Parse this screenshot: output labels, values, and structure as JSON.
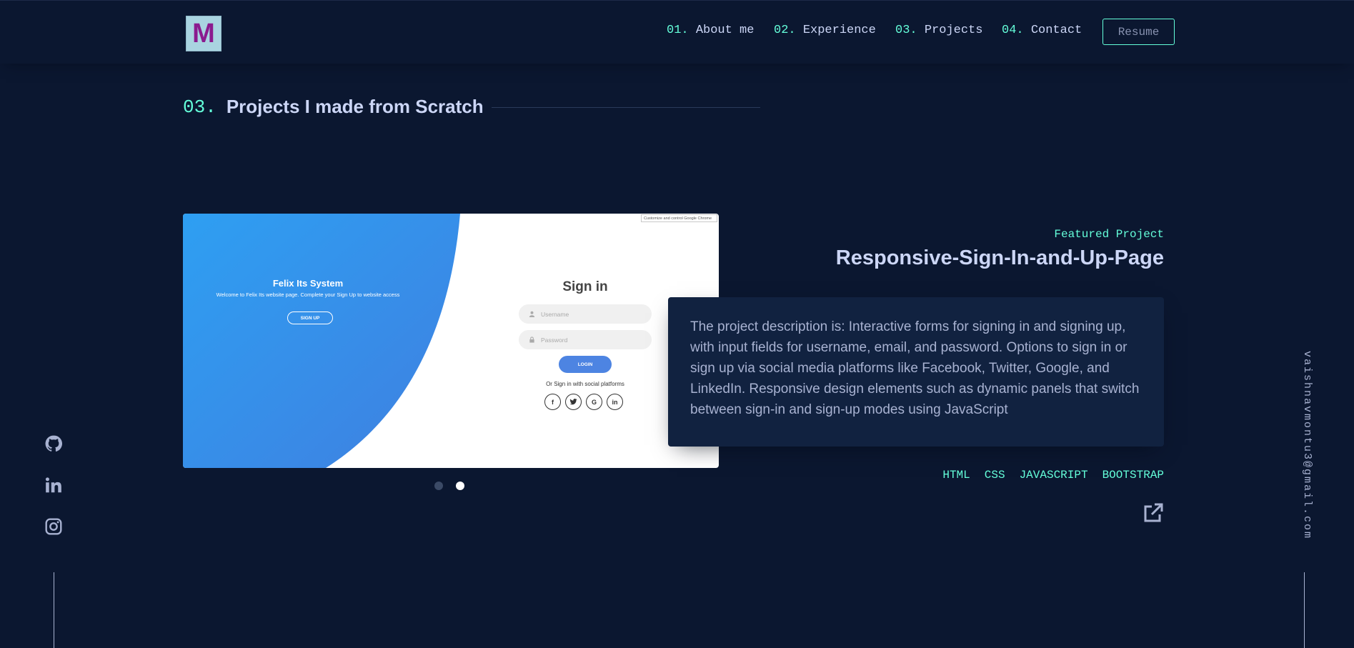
{
  "header": {
    "logo_letter": "M",
    "nav": [
      {
        "num": "01.",
        "label": "About me"
      },
      {
        "num": "02.",
        "label": "Experience"
      },
      {
        "num": "03.",
        "label": "Projects"
      },
      {
        "num": "04.",
        "label": "Contact"
      }
    ],
    "resume_label": "Resume"
  },
  "section": {
    "num": "03.",
    "title": "Projects I made from Scratch"
  },
  "project": {
    "featured_label": "Featured Project",
    "title": "Responsive-Sign-In-and-Up-Page",
    "description": "The project description is: Interactive forms for signing in and signing up, with input fields for username, email, and password. Options to sign in or sign up via social media platforms like Facebook, Twitter, Google, and LinkedIn. Responsive design elements such as dynamic panels that switch between sign-in and sign-up modes using JavaScript",
    "tags": [
      "HTML",
      "CSS",
      "JAVASCRIPT",
      "BOOTSTRAP"
    ],
    "external_link_icon": "external-link-icon",
    "screenshot": {
      "brand": "Felix Its System",
      "brand_text": "Welcome to Felix Its website page. Complete your Sign Up to website access",
      "signup_label": "SIGN UP",
      "tooltip": "Customize and control Google Chrome",
      "signin_title": "Sign in",
      "username_placeholder": "Username",
      "password_placeholder": "Password",
      "login_label": "LOGIN",
      "social_text": "Or Sign in with social platforms",
      "socials": [
        "f",
        "t",
        "G",
        "in"
      ]
    },
    "carousel": {
      "count": 2,
      "active_index": 1
    }
  },
  "social_links": [
    "github-icon",
    "linkedin-icon",
    "instagram-icon"
  ],
  "email": "vaishnavmontu3@gmail.com",
  "colors": {
    "background": "#0b1730",
    "accent": "#64ffda",
    "panel": "#112240",
    "text": "#ccd6f6",
    "muted": "#a8b2d1",
    "screenshot_blue": "#2e9bf0"
  }
}
